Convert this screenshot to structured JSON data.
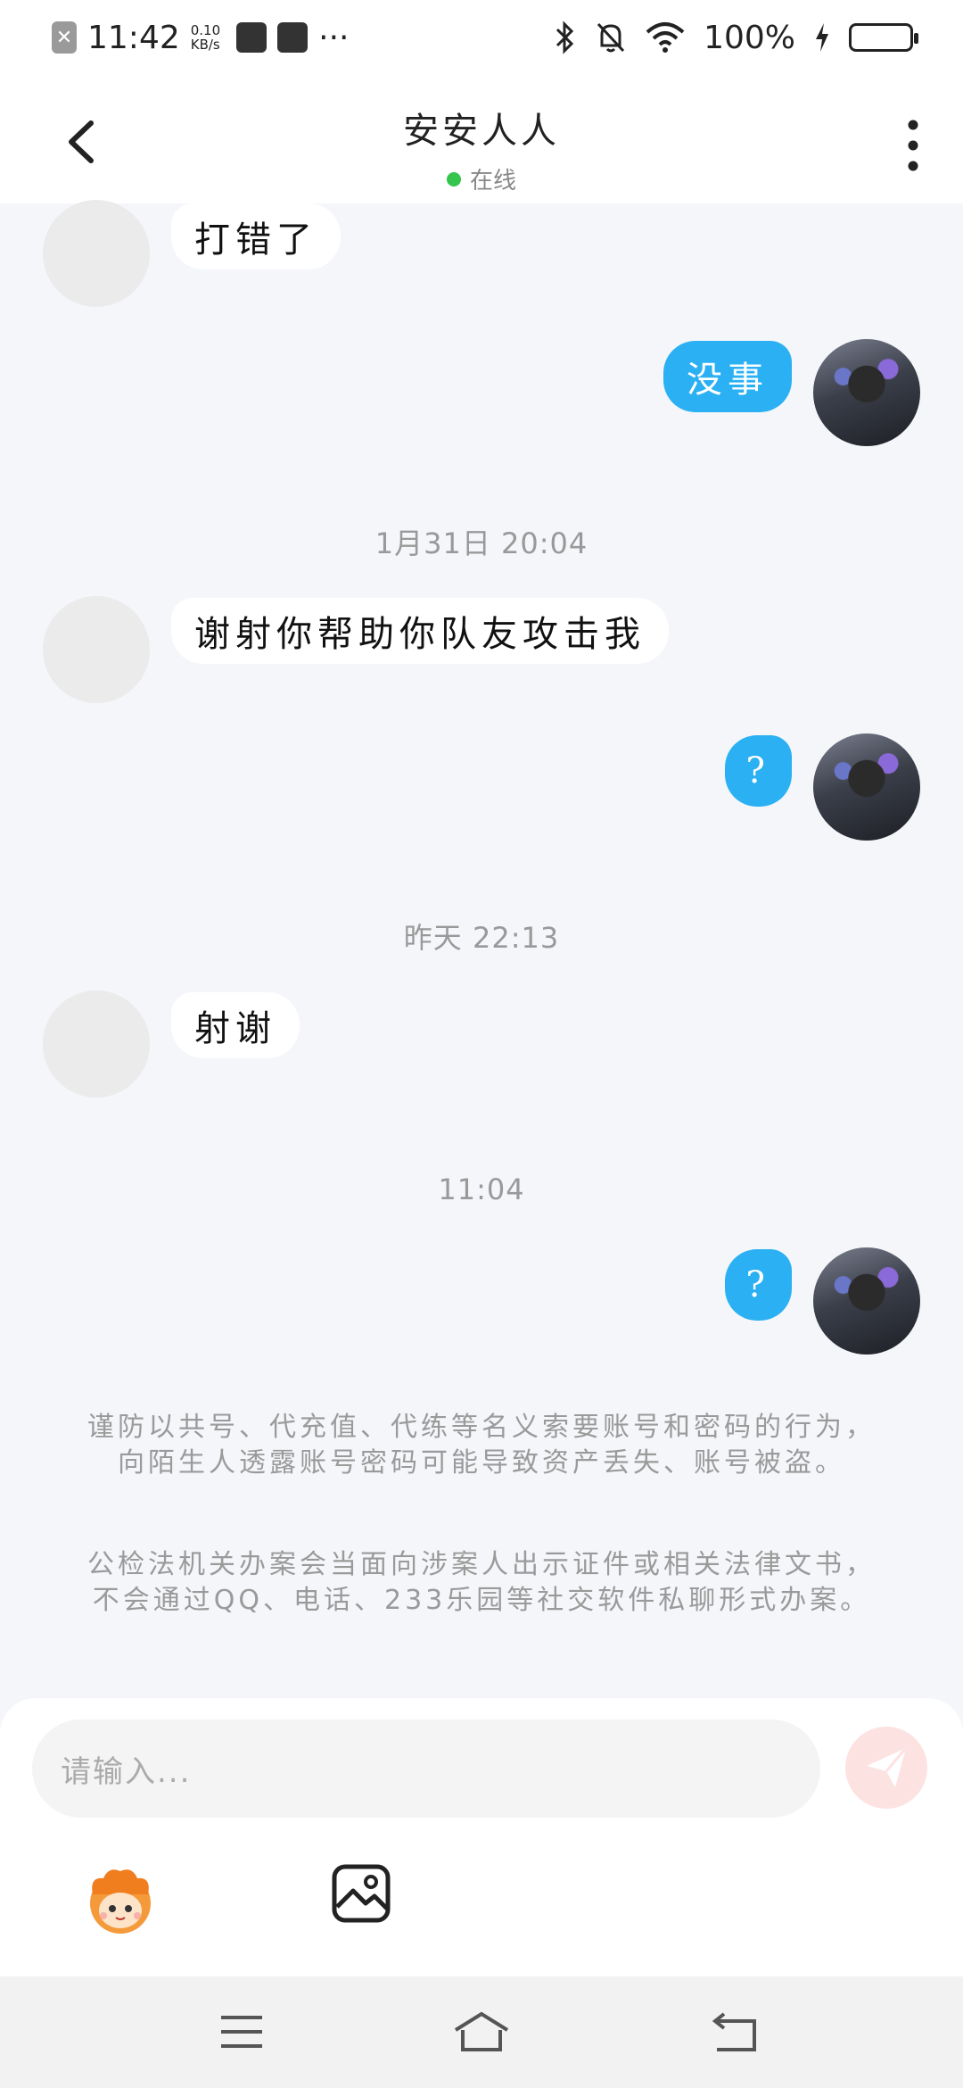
{
  "status_bar": {
    "time": "11:42",
    "speed_value": "0.10",
    "speed_unit": "KB/s",
    "more": "···",
    "battery": "100%",
    "icons": [
      "close-notification-icon",
      "sim-icon",
      "shopping-bag-icon",
      "bluetooth-icon",
      "mute-icon",
      "wifi-icon",
      "charging-icon",
      "battery-icon"
    ]
  },
  "header": {
    "title": "安安人人",
    "status": "在线",
    "status_color": "#35c44c",
    "icons": [
      "back-arrow-icon",
      "more-vertical-icon"
    ]
  },
  "messages": [
    {
      "from": "peer",
      "text": "打错了"
    },
    {
      "from": "me",
      "text": "没事"
    },
    {
      "type": "timestamp",
      "text": "1月31日 20:04"
    },
    {
      "from": "peer",
      "text": "谢射你帮助你队友攻击我"
    },
    {
      "from": "me",
      "text": "?"
    },
    {
      "type": "timestamp",
      "text": "昨天 22:13"
    },
    {
      "from": "peer",
      "text": "射谢"
    },
    {
      "type": "timestamp",
      "text": "11:04"
    },
    {
      "from": "me",
      "text": "?"
    }
  ],
  "notices": [
    "谨防以共号、代充值、代练等名义索要账号和密码的行为，向陌生人透露账号密码可能导致资产丢失、账号被盗。",
    "公检法机关办案会当面向涉案人出示证件或相关法律文书，不会通过QQ、电话、233乐园等社交软件私聊形式办案。"
  ],
  "composer": {
    "placeholder": "请输入...",
    "icons": [
      "send-icon",
      "emoji-mascot-icon",
      "image-icon"
    ],
    "accent": "#2ab0f3"
  },
  "navbar": {
    "icons": [
      "menu-icon",
      "home-icon",
      "back-icon"
    ]
  }
}
